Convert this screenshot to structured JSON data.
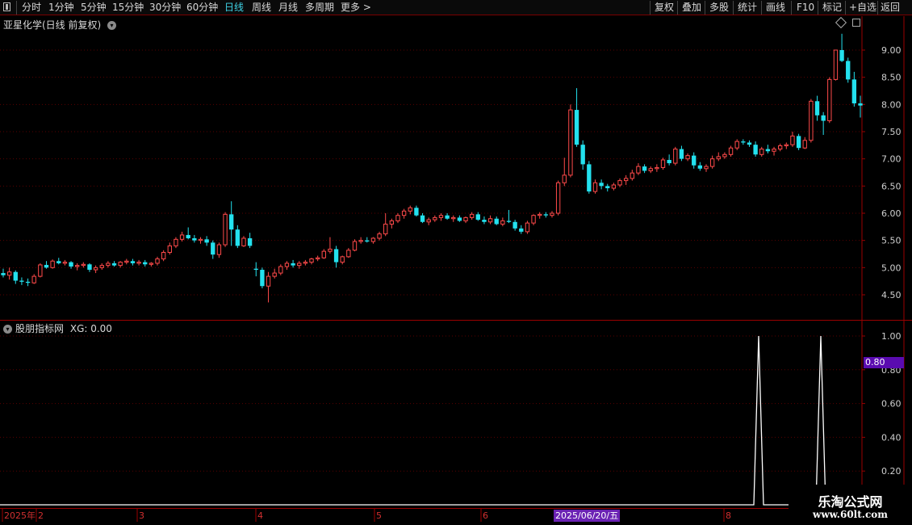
{
  "toolbar": {
    "periods": [
      "分时",
      "1分钟",
      "5分钟",
      "15分钟",
      "30分钟",
      "60分钟",
      "日线",
      "周线",
      "月线",
      "多周期",
      "更多 >"
    ],
    "active": "日线",
    "actions": [
      "复权",
      "叠加",
      "多股",
      "统计",
      "画线",
      "F10",
      "标记",
      "+自选",
      "返回"
    ]
  },
  "main_panel": {
    "title": "亚星化学(日线 前复权)"
  },
  "indicator_panel": {
    "title": "股朋指标网",
    "value_label": "XG: 0.00",
    "cursor_badge": "0.80"
  },
  "date_axis": {
    "labels": [
      "2025年",
      "2",
      "3",
      "4",
      "5",
      "6",
      "8"
    ],
    "highlight": "2025/06/20/五"
  },
  "watermark": {
    "line1": "乐淘公式网",
    "line2": "www.60lt.com"
  },
  "colors": {
    "up": "#ff4a4a",
    "down": "#23e1ee",
    "grid": "#5a0000",
    "axis_text": "#cfcfcf",
    "badge": "#5a0bb0"
  },
  "chart_data": [
    {
      "type": "candlestick",
      "y_ticks": [
        "9.00",
        "8.50",
        "8.00",
        "7.50",
        "7.00",
        "6.50",
        "6.00",
        "5.50",
        "5.00",
        "4.50"
      ],
      "ylim": [
        4.2,
        9.5
      ],
      "ohlc": [
        [
          4.9,
          4.98,
          4.82,
          4.86
        ],
        [
          4.86,
          5.0,
          4.78,
          4.92
        ],
        [
          4.92,
          4.95,
          4.7,
          4.76
        ],
        [
          4.76,
          4.82,
          4.68,
          4.74
        ],
        [
          4.74,
          4.8,
          4.66,
          4.72
        ],
        [
          4.72,
          4.88,
          4.7,
          4.84
        ],
        [
          4.84,
          5.08,
          4.82,
          5.05
        ],
        [
          5.05,
          5.12,
          4.98,
          5.0
        ],
        [
          5.0,
          5.15,
          4.98,
          5.12
        ],
        [
          5.12,
          5.18,
          5.06,
          5.08
        ],
        [
          5.08,
          5.14,
          5.04,
          5.1
        ],
        [
          5.1,
          5.12,
          4.98,
          5.02
        ],
        [
          5.02,
          5.08,
          4.95,
          5.04
        ],
        [
          5.04,
          5.1,
          5.0,
          5.06
        ],
        [
          5.06,
          5.08,
          4.92,
          4.96
        ],
        [
          4.96,
          5.04,
          4.9,
          5.0
        ],
        [
          5.0,
          5.08,
          4.96,
          5.04
        ],
        [
          5.04,
          5.12,
          5.0,
          5.08
        ],
        [
          5.08,
          5.12,
          5.02,
          5.04
        ],
        [
          5.04,
          5.12,
          5.0,
          5.1
        ],
        [
          5.1,
          5.16,
          5.06,
          5.12
        ],
        [
          5.12,
          5.16,
          5.04,
          5.08
        ],
        [
          5.08,
          5.14,
          5.04,
          5.1
        ],
        [
          5.1,
          5.14,
          5.02,
          5.06
        ],
        [
          5.06,
          5.1,
          5.02,
          5.08
        ],
        [
          5.08,
          5.2,
          5.04,
          5.16
        ],
        [
          5.16,
          5.32,
          5.12,
          5.28
        ],
        [
          5.28,
          5.46,
          5.24,
          5.4
        ],
        [
          5.4,
          5.56,
          5.36,
          5.52
        ],
        [
          5.52,
          5.66,
          5.48,
          5.6
        ],
        [
          5.6,
          5.74,
          5.52,
          5.54
        ],
        [
          5.54,
          5.6,
          5.46,
          5.5
        ],
        [
          5.5,
          5.56,
          5.44,
          5.52
        ],
        [
          5.52,
          5.58,
          5.4,
          5.46
        ],
        [
          5.46,
          5.5,
          5.16,
          5.24
        ],
        [
          5.24,
          5.46,
          5.18,
          5.42
        ],
        [
          5.42,
          6.02,
          5.38,
          5.98
        ],
        [
          5.98,
          6.22,
          5.4,
          5.7
        ],
        [
          5.7,
          5.78,
          5.36,
          5.4
        ],
        [
          5.4,
          5.58,
          5.38,
          5.54
        ],
        [
          5.54,
          5.64,
          5.36,
          5.4
        ],
        [
          4.98,
          5.1,
          4.84,
          4.96
        ],
        [
          4.96,
          5.0,
          4.62,
          4.66
        ],
        [
          4.66,
          4.92,
          4.36,
          4.84
        ],
        [
          4.84,
          4.98,
          4.8,
          4.9
        ],
        [
          4.9,
          5.06,
          4.86,
          5.02
        ],
        [
          5.02,
          5.12,
          4.96,
          5.08
        ],
        [
          5.08,
          5.14,
          5.0,
          5.04
        ],
        [
          5.04,
          5.12,
          4.98,
          5.08
        ],
        [
          5.08,
          5.14,
          5.04,
          5.1
        ],
        [
          5.1,
          5.18,
          5.06,
          5.16
        ],
        [
          5.16,
          5.22,
          5.12,
          5.18
        ],
        [
          5.18,
          5.34,
          5.16,
          5.3
        ],
        [
          5.3,
          5.56,
          5.26,
          5.34
        ],
        [
          5.34,
          5.4,
          5.0,
          5.1
        ],
        [
          5.1,
          5.22,
          5.06,
          5.2
        ],
        [
          5.2,
          5.36,
          5.18,
          5.32
        ],
        [
          5.32,
          5.52,
          5.3,
          5.48
        ],
        [
          5.48,
          5.56,
          5.44,
          5.5
        ],
        [
          5.5,
          5.56,
          5.46,
          5.48
        ],
        [
          5.48,
          5.56,
          5.44,
          5.54
        ],
        [
          5.54,
          5.66,
          5.5,
          5.62
        ],
        [
          5.62,
          6.0,
          5.58,
          5.8
        ],
        [
          5.8,
          5.9,
          5.72,
          5.86
        ],
        [
          5.86,
          6.0,
          5.82,
          5.96
        ],
        [
          5.96,
          6.08,
          5.9,
          6.04
        ],
        [
          6.04,
          6.14,
          5.98,
          6.1
        ],
        [
          6.1,
          6.14,
          5.94,
          5.96
        ],
        [
          5.96,
          6.0,
          5.82,
          5.84
        ],
        [
          5.84,
          5.92,
          5.78,
          5.88
        ],
        [
          5.88,
          5.96,
          5.84,
          5.92
        ],
        [
          5.92,
          6.0,
          5.86,
          5.96
        ],
        [
          5.96,
          6.0,
          5.88,
          5.9
        ],
        [
          5.9,
          5.96,
          5.84,
          5.92
        ],
        [
          5.92,
          5.96,
          5.84,
          5.86
        ],
        [
          5.86,
          5.94,
          5.82,
          5.92
        ],
        [
          5.92,
          6.02,
          5.88,
          5.98
        ],
        [
          5.98,
          6.02,
          5.86,
          5.88
        ],
        [
          5.88,
          5.94,
          5.8,
          5.84
        ],
        [
          5.84,
          5.96,
          5.8,
          5.9
        ],
        [
          5.9,
          5.94,
          5.78,
          5.8
        ],
        [
          5.8,
          5.92,
          5.76,
          5.86
        ],
        [
          5.86,
          6.06,
          5.82,
          5.84
        ],
        [
          5.84,
          5.88,
          5.68,
          5.72
        ],
        [
          5.72,
          5.78,
          5.62,
          5.66
        ],
        [
          5.66,
          5.86,
          5.62,
          5.82
        ],
        [
          5.82,
          5.98,
          5.78,
          5.96
        ],
        [
          5.96,
          6.02,
          5.9,
          5.98
        ],
        [
          5.98,
          6.02,
          5.92,
          5.96
        ],
        [
          5.96,
          6.04,
          5.92,
          6.0
        ],
        [
          6.0,
          6.6,
          5.96,
          6.56
        ],
        [
          6.56,
          7.02,
          6.5,
          6.7
        ],
        [
          6.7,
          8.0,
          6.66,
          7.9
        ],
        [
          7.9,
          8.3,
          7.22,
          7.26
        ],
        [
          7.26,
          7.34,
          6.8,
          6.9
        ],
        [
          6.9,
          6.96,
          6.36,
          6.4
        ],
        [
          6.4,
          6.62,
          6.36,
          6.56
        ],
        [
          6.56,
          6.62,
          6.44,
          6.5
        ],
        [
          6.5,
          6.54,
          6.4,
          6.46
        ],
        [
          6.46,
          6.56,
          6.42,
          6.52
        ],
        [
          6.52,
          6.64,
          6.48,
          6.6
        ],
        [
          6.6,
          6.7,
          6.52,
          6.64
        ],
        [
          6.64,
          6.8,
          6.6,
          6.74
        ],
        [
          6.74,
          6.92,
          6.7,
          6.86
        ],
        [
          6.86,
          6.9,
          6.74,
          6.78
        ],
        [
          6.78,
          6.86,
          6.74,
          6.82
        ],
        [
          6.82,
          6.9,
          6.76,
          6.84
        ],
        [
          6.84,
          7.02,
          6.8,
          6.98
        ],
        [
          6.98,
          7.08,
          6.88,
          6.92
        ],
        [
          6.92,
          7.22,
          6.88,
          7.18
        ],
        [
          7.18,
          7.24,
          6.96,
          7.0
        ],
        [
          7.0,
          7.1,
          6.96,
          7.06
        ],
        [
          7.06,
          7.12,
          6.82,
          6.88
        ],
        [
          6.88,
          6.94,
          6.78,
          6.82
        ],
        [
          6.82,
          6.9,
          6.76,
          6.86
        ],
        [
          6.86,
          7.06,
          6.82,
          7.0
        ],
        [
          7.0,
          7.12,
          6.96,
          7.04
        ],
        [
          7.04,
          7.12,
          7.0,
          7.08
        ],
        [
          7.08,
          7.24,
          7.04,
          7.2
        ],
        [
          7.2,
          7.36,
          7.16,
          7.32
        ],
        [
          7.32,
          7.36,
          7.26,
          7.3
        ],
        [
          7.3,
          7.34,
          7.22,
          7.26
        ],
        [
          7.26,
          7.32,
          7.04,
          7.08
        ],
        [
          7.08,
          7.22,
          7.04,
          7.18
        ],
        [
          7.18,
          7.26,
          7.1,
          7.14
        ],
        [
          7.14,
          7.22,
          7.06,
          7.18
        ],
        [
          7.18,
          7.28,
          7.14,
          7.24
        ],
        [
          7.24,
          7.3,
          7.18,
          7.26
        ],
        [
          7.26,
          7.5,
          7.22,
          7.42
        ],
        [
          7.42,
          7.46,
          7.16,
          7.2
        ],
        [
          7.2,
          7.4,
          7.18,
          7.34
        ],
        [
          7.34,
          8.1,
          7.3,
          8.06
        ],
        [
          8.06,
          8.16,
          7.7,
          7.8
        ],
        [
          7.8,
          7.86,
          7.44,
          7.7
        ],
        [
          7.7,
          8.5,
          7.66,
          8.46
        ],
        [
          8.46,
          9.0,
          8.44,
          9.0
        ],
        [
          9.0,
          9.3,
          8.78,
          8.8
        ],
        [
          8.8,
          8.86,
          8.4,
          8.46
        ],
        [
          8.46,
          8.6,
          7.96,
          8.02
        ],
        [
          8.02,
          8.16,
          7.76,
          7.98
        ]
      ]
    },
    {
      "type": "line",
      "y_ticks": [
        "1.00",
        "0.80",
        "0.60",
        "0.40",
        "0.20"
      ],
      "ylim": [
        0,
        1
      ],
      "spikes": [
        {
          "label": "spike-1",
          "value": 1.0
        },
        {
          "label": "spike-2",
          "value": 1.0
        }
      ]
    }
  ]
}
